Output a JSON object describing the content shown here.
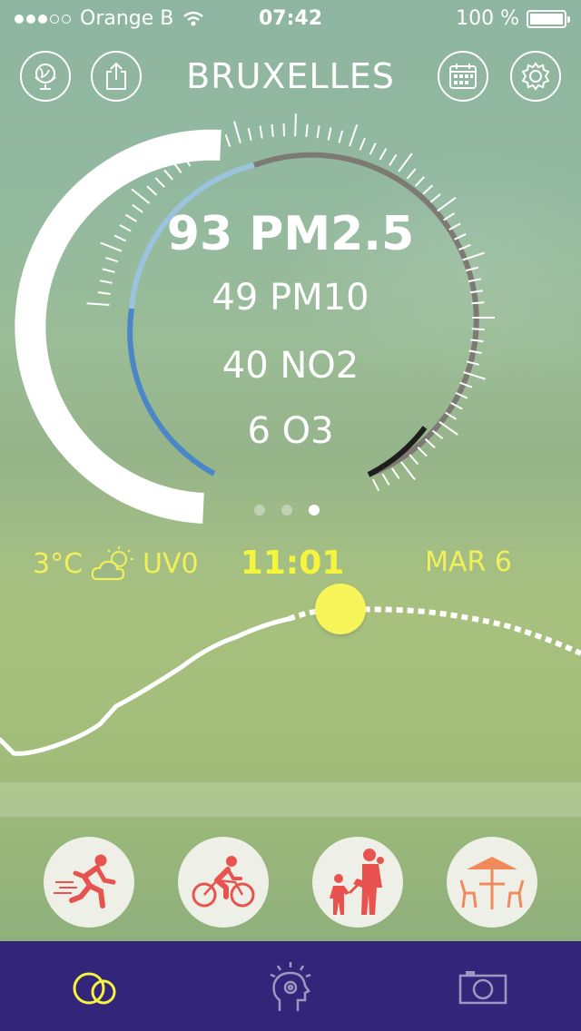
{
  "status_bar": {
    "carrier": "Orange B",
    "time": "07:42",
    "battery": "100 %",
    "signal_bars_filled": 3,
    "signal_bars_total": 5,
    "battery_level": 1.0
  },
  "header": {
    "title": "BRUXELLES",
    "icons": [
      "globe-icon",
      "share-icon",
      "calendar-icon",
      "gear-icon"
    ]
  },
  "readings": {
    "main": "93 PM2.5",
    "pm10": "49 PM10",
    "no2": "40 NO2",
    "o3": "6 O3"
  },
  "pager": {
    "pages": 3,
    "active": 3
  },
  "weather": {
    "temperature": "3°C",
    "uv": "UV0",
    "time": "11:01",
    "date": "MAR 6",
    "icon": "partly-cloudy-icon"
  },
  "activities": [
    {
      "name": "running",
      "icon": "runner-icon"
    },
    {
      "name": "cycling",
      "icon": "cyclist-icon"
    },
    {
      "name": "family",
      "icon": "family-icon"
    },
    {
      "name": "terrace",
      "icon": "terrace-icon"
    }
  ],
  "tabbar": {
    "tabs": [
      {
        "name": "air",
        "icon": "cloud-icon",
        "active": true
      },
      {
        "name": "tips",
        "icon": "idea-head-icon",
        "active": false
      },
      {
        "name": "camera",
        "icon": "camera-icon",
        "active": false
      }
    ]
  },
  "colors": {
    "accent_yellow": "#f5f53d",
    "activity_red": "#e8534f",
    "tabbar_bg": "#33267a",
    "gauge_blue": "#4a86c8",
    "gauge_light_blue": "#9cc3dc",
    "gauge_gray": "#7d7a74"
  }
}
